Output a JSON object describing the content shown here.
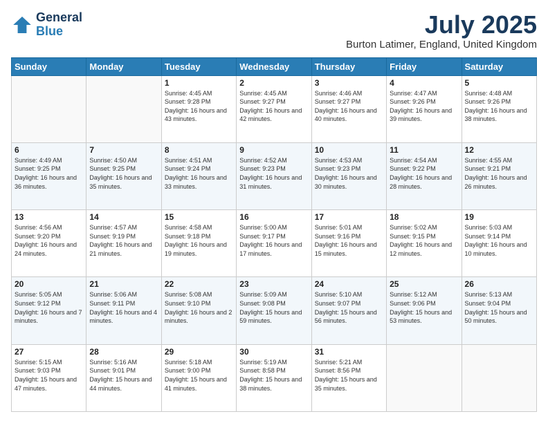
{
  "header": {
    "logo_line1": "General",
    "logo_line2": "Blue",
    "month": "July 2025",
    "location": "Burton Latimer, England, United Kingdom"
  },
  "days_of_week": [
    "Sunday",
    "Monday",
    "Tuesday",
    "Wednesday",
    "Thursday",
    "Friday",
    "Saturday"
  ],
  "weeks": [
    [
      {
        "day": "",
        "info": ""
      },
      {
        "day": "",
        "info": ""
      },
      {
        "day": "1",
        "info": "Sunrise: 4:45 AM\nSunset: 9:28 PM\nDaylight: 16 hours and 43 minutes."
      },
      {
        "day": "2",
        "info": "Sunrise: 4:45 AM\nSunset: 9:27 PM\nDaylight: 16 hours and 42 minutes."
      },
      {
        "day": "3",
        "info": "Sunrise: 4:46 AM\nSunset: 9:27 PM\nDaylight: 16 hours and 40 minutes."
      },
      {
        "day": "4",
        "info": "Sunrise: 4:47 AM\nSunset: 9:26 PM\nDaylight: 16 hours and 39 minutes."
      },
      {
        "day": "5",
        "info": "Sunrise: 4:48 AM\nSunset: 9:26 PM\nDaylight: 16 hours and 38 minutes."
      }
    ],
    [
      {
        "day": "6",
        "info": "Sunrise: 4:49 AM\nSunset: 9:25 PM\nDaylight: 16 hours and 36 minutes."
      },
      {
        "day": "7",
        "info": "Sunrise: 4:50 AM\nSunset: 9:25 PM\nDaylight: 16 hours and 35 minutes."
      },
      {
        "day": "8",
        "info": "Sunrise: 4:51 AM\nSunset: 9:24 PM\nDaylight: 16 hours and 33 minutes."
      },
      {
        "day": "9",
        "info": "Sunrise: 4:52 AM\nSunset: 9:23 PM\nDaylight: 16 hours and 31 minutes."
      },
      {
        "day": "10",
        "info": "Sunrise: 4:53 AM\nSunset: 9:23 PM\nDaylight: 16 hours and 30 minutes."
      },
      {
        "day": "11",
        "info": "Sunrise: 4:54 AM\nSunset: 9:22 PM\nDaylight: 16 hours and 28 minutes."
      },
      {
        "day": "12",
        "info": "Sunrise: 4:55 AM\nSunset: 9:21 PM\nDaylight: 16 hours and 26 minutes."
      }
    ],
    [
      {
        "day": "13",
        "info": "Sunrise: 4:56 AM\nSunset: 9:20 PM\nDaylight: 16 hours and 24 minutes."
      },
      {
        "day": "14",
        "info": "Sunrise: 4:57 AM\nSunset: 9:19 PM\nDaylight: 16 hours and 21 minutes."
      },
      {
        "day": "15",
        "info": "Sunrise: 4:58 AM\nSunset: 9:18 PM\nDaylight: 16 hours and 19 minutes."
      },
      {
        "day": "16",
        "info": "Sunrise: 5:00 AM\nSunset: 9:17 PM\nDaylight: 16 hours and 17 minutes."
      },
      {
        "day": "17",
        "info": "Sunrise: 5:01 AM\nSunset: 9:16 PM\nDaylight: 16 hours and 15 minutes."
      },
      {
        "day": "18",
        "info": "Sunrise: 5:02 AM\nSunset: 9:15 PM\nDaylight: 16 hours and 12 minutes."
      },
      {
        "day": "19",
        "info": "Sunrise: 5:03 AM\nSunset: 9:14 PM\nDaylight: 16 hours and 10 minutes."
      }
    ],
    [
      {
        "day": "20",
        "info": "Sunrise: 5:05 AM\nSunset: 9:12 PM\nDaylight: 16 hours and 7 minutes."
      },
      {
        "day": "21",
        "info": "Sunrise: 5:06 AM\nSunset: 9:11 PM\nDaylight: 16 hours and 4 minutes."
      },
      {
        "day": "22",
        "info": "Sunrise: 5:08 AM\nSunset: 9:10 PM\nDaylight: 16 hours and 2 minutes."
      },
      {
        "day": "23",
        "info": "Sunrise: 5:09 AM\nSunset: 9:08 PM\nDaylight: 15 hours and 59 minutes."
      },
      {
        "day": "24",
        "info": "Sunrise: 5:10 AM\nSunset: 9:07 PM\nDaylight: 15 hours and 56 minutes."
      },
      {
        "day": "25",
        "info": "Sunrise: 5:12 AM\nSunset: 9:06 PM\nDaylight: 15 hours and 53 minutes."
      },
      {
        "day": "26",
        "info": "Sunrise: 5:13 AM\nSunset: 9:04 PM\nDaylight: 15 hours and 50 minutes."
      }
    ],
    [
      {
        "day": "27",
        "info": "Sunrise: 5:15 AM\nSunset: 9:03 PM\nDaylight: 15 hours and 47 minutes."
      },
      {
        "day": "28",
        "info": "Sunrise: 5:16 AM\nSunset: 9:01 PM\nDaylight: 15 hours and 44 minutes."
      },
      {
        "day": "29",
        "info": "Sunrise: 5:18 AM\nSunset: 9:00 PM\nDaylight: 15 hours and 41 minutes."
      },
      {
        "day": "30",
        "info": "Sunrise: 5:19 AM\nSunset: 8:58 PM\nDaylight: 15 hours and 38 minutes."
      },
      {
        "day": "31",
        "info": "Sunrise: 5:21 AM\nSunset: 8:56 PM\nDaylight: 15 hours and 35 minutes."
      },
      {
        "day": "",
        "info": ""
      },
      {
        "day": "",
        "info": ""
      }
    ]
  ]
}
